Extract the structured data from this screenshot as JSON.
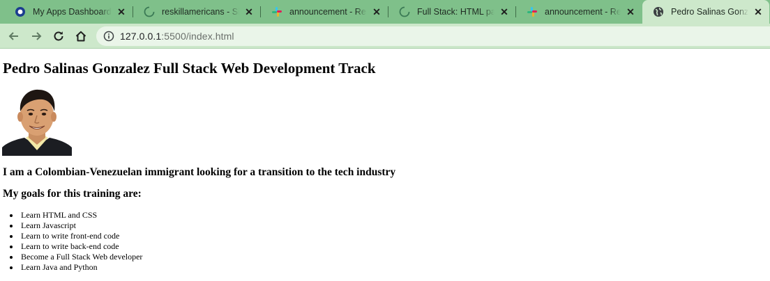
{
  "browser": {
    "tabs": [
      {
        "title": "My Apps Dashboard | ",
        "icon": "okta-icon",
        "active": false
      },
      {
        "title": "reskillamericans - Sign",
        "icon": "loading-spinner-icon",
        "active": false
      },
      {
        "title": "announcement - Reski",
        "icon": "slack-icon",
        "active": false
      },
      {
        "title": "Full Stack: HTML page",
        "icon": "loading-spinner-icon",
        "active": false
      },
      {
        "title": "announcement - Reski",
        "icon": "slack-icon",
        "active": false
      },
      {
        "title": "Pedro Salinas Gonzale",
        "icon": "globe-icon",
        "active": true
      }
    ],
    "tab_close_glyph": "✕",
    "address_bar": {
      "host": "127.0.0.1",
      "path": ":5500/index.html"
    },
    "theme": {
      "tabstrip": "#7fc08a",
      "toolbar": "#cde8cb",
      "omnibox": "#eaf5e9"
    }
  },
  "page": {
    "title": "Pedro Salinas Gonzalez Full Stack Web Development Track",
    "portrait_icon": "portrait-photo",
    "intro": "I am a Colombian-Venezuelan immigrant looking for a transition to the tech industry",
    "goals_heading": "My goals for this training are:",
    "goals": [
      "Learn HTML and CSS",
      "Learn Javascript",
      "Learn to write front-end code",
      "Learn to write back-end code",
      "Become a Full Stack Web developer",
      "Learn Java and Python"
    ]
  }
}
